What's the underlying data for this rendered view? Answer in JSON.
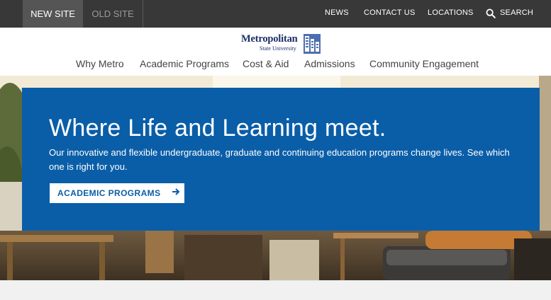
{
  "utility_bar": {
    "site_tabs": [
      {
        "label": "NEW SITE",
        "active": true
      },
      {
        "label": "OLD SITE",
        "active": false
      }
    ],
    "links": {
      "news": "NEWS",
      "contact": "CONTACT US",
      "locations": "LOCATIONS",
      "search": "SEARCH"
    },
    "search_icon": "search-icon"
  },
  "logo": {
    "name": "Metropolitan",
    "subtitle": "State University",
    "mark_icon": "building-icon"
  },
  "main_nav": [
    {
      "label": "Why Metro"
    },
    {
      "label": "Academic Programs"
    },
    {
      "label": "Cost & Aid"
    },
    {
      "label": "Admissions"
    },
    {
      "label": "Community Engagement"
    }
  ],
  "hero": {
    "title": "Where Life and Learning meet.",
    "description": "Our innovative and flexible undergraduate, graduate and continuing education programs change lives. See which one is right for you.",
    "cta_label": "ACADEMIC PROGRAMS",
    "cta_icon": "arrow-right-icon"
  },
  "colors": {
    "utility_bg": "#383838",
    "active_tab_bg": "#555555",
    "hero_blue": "#0a5ea8",
    "brand_navy": "#1c2f6a",
    "nav_text": "#444444"
  }
}
